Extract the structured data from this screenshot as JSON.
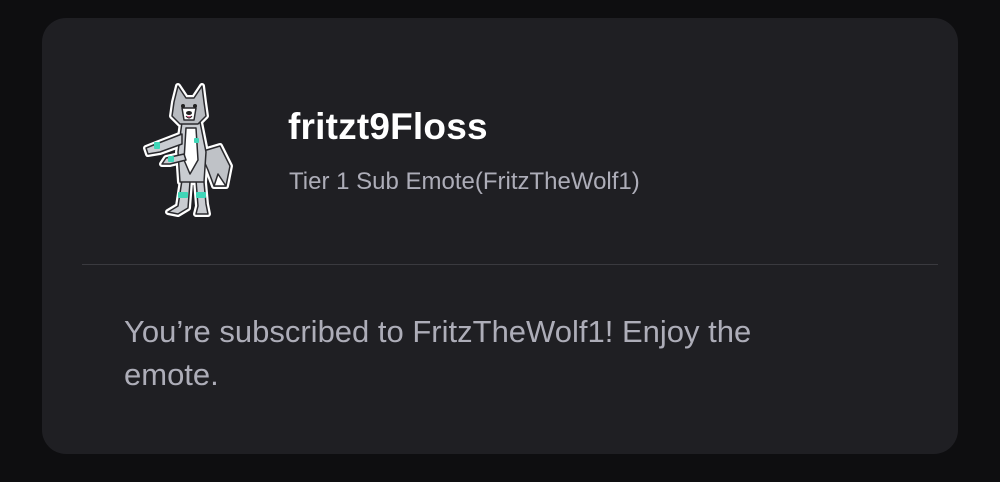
{
  "emote": {
    "name": "fritzt9Floss",
    "tier_label": "Tier 1 Sub Emote(FritzTheWolf1)",
    "image_icon": "wolf-emote-icon"
  },
  "message": {
    "text": "You’re subscribed to FritzTheWolf1! Enjoy the emote."
  },
  "colors": {
    "background": "#0e0e10",
    "card": "#1f1f23",
    "title": "#ffffff",
    "secondary_text": "#adadb8",
    "divider": "#3a3a3f",
    "emote_accent": "#3fd6b8"
  }
}
